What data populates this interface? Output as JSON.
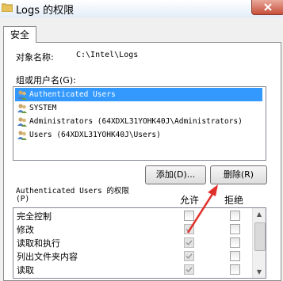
{
  "window": {
    "title": "Logs 的权限"
  },
  "tabs": [
    {
      "label": "安全"
    }
  ],
  "object": {
    "label": "对象名称:",
    "value": "C:\\Intel\\Logs"
  },
  "groups": {
    "label": "组或用户名(G):",
    "items": [
      {
        "label": "Authenticated Users",
        "selected": true
      },
      {
        "label": "SYSTEM",
        "selected": false
      },
      {
        "label": "Administrators (64XDXL31YOHK40J\\Administrators)",
        "selected": false
      },
      {
        "label": "Users (64XDXL31YOHK40J\\Users)",
        "selected": false
      }
    ]
  },
  "buttons": {
    "add": "添加(D)...",
    "remove": "删除(R)"
  },
  "permissions": {
    "title_line1": "Authenticated Users 的权限",
    "title_line2": "(P)",
    "allow_header": "允许",
    "deny_header": "拒绝",
    "rows": [
      {
        "name": "完全控制",
        "allow": false,
        "deny": false,
        "allow_dimmed": false
      },
      {
        "name": "修改",
        "allow": true,
        "deny": false,
        "allow_dimmed": true
      },
      {
        "name": "读取和执行",
        "allow": true,
        "deny": false,
        "allow_dimmed": true
      },
      {
        "name": "列出文件夹内容",
        "allow": true,
        "deny": false,
        "allow_dimmed": true
      },
      {
        "name": "读取",
        "allow": true,
        "deny": false,
        "allow_dimmed": true
      }
    ]
  },
  "colors": {
    "selection": "#3399ff",
    "arrow": "#e0302a",
    "close_button": "#c7503b"
  },
  "icons": {
    "window": "folder-icon",
    "user": "users-icon",
    "close": "close-icon"
  }
}
